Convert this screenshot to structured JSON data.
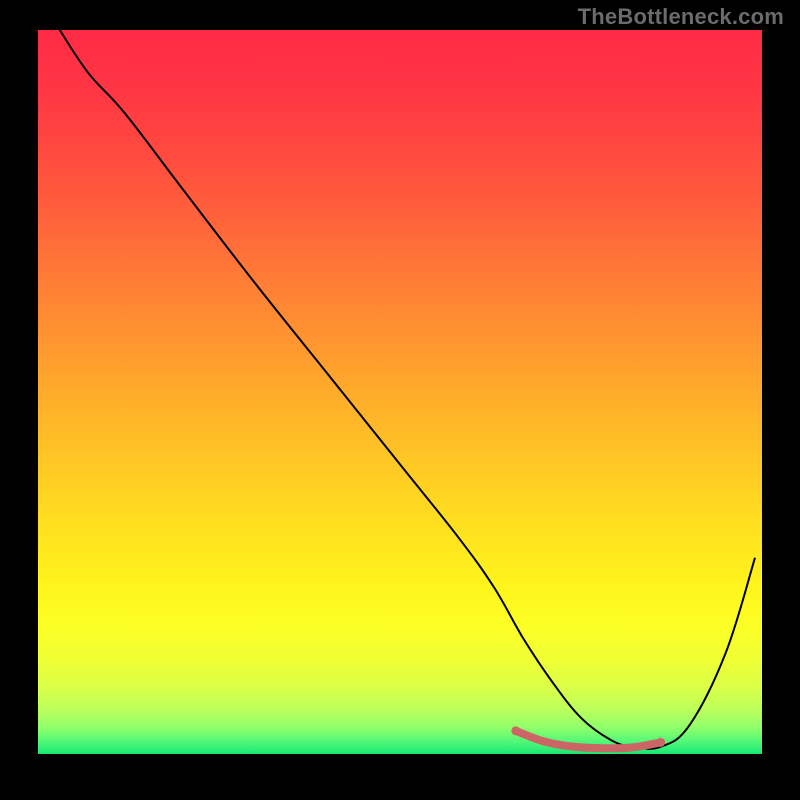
{
  "watermark": {
    "text": "TheBottleneck.com"
  },
  "gradient": {
    "stops": [
      {
        "offset": 0.0,
        "color": "#ff2b46"
      },
      {
        "offset": 0.085,
        "color": "#ff3643"
      },
      {
        "offset": 0.17,
        "color": "#ff4a3f"
      },
      {
        "offset": 0.255,
        "color": "#ff613b"
      },
      {
        "offset": 0.34,
        "color": "#ff7b36"
      },
      {
        "offset": 0.425,
        "color": "#ff9430"
      },
      {
        "offset": 0.51,
        "color": "#ffae2a"
      },
      {
        "offset": 0.6,
        "color": "#ffc824"
      },
      {
        "offset": 0.685,
        "color": "#ffe01f"
      },
      {
        "offset": 0.765,
        "color": "#fff41c"
      },
      {
        "offset": 0.82,
        "color": "#fdff24"
      },
      {
        "offset": 0.87,
        "color": "#efff34"
      },
      {
        "offset": 0.91,
        "color": "#d9ff48"
      },
      {
        "offset": 0.94,
        "color": "#b9ff5c"
      },
      {
        "offset": 0.965,
        "color": "#8cff6c"
      },
      {
        "offset": 0.982,
        "color": "#55f878"
      },
      {
        "offset": 1.0,
        "color": "#18e874"
      }
    ]
  },
  "chart_data": {
    "type": "line",
    "title": "",
    "xlabel": "",
    "ylabel": "",
    "xlim": [
      0,
      100
    ],
    "ylim": [
      0,
      100
    ],
    "series": [
      {
        "name": "bottleneck-curve",
        "color": "#000000",
        "stroke_width": 2,
        "x": [
          3,
          7,
          12,
          20,
          30,
          40,
          50,
          58,
          63,
          67,
          71,
          75,
          79,
          82,
          86,
          90,
          95,
          99
        ],
        "y": [
          100,
          94,
          88.5,
          78,
          65,
          52.5,
          40,
          30,
          23,
          16,
          10,
          5,
          2,
          1,
          1,
          4,
          14,
          27
        ]
      }
    ],
    "emphasis_segment": {
      "color": "#cc6666",
      "stroke_width": 8,
      "dots_radius": 4.5,
      "x": [
        66,
        70,
        74,
        78,
        82,
        86
      ],
      "y": [
        3.2,
        1.7,
        1.0,
        0.8,
        0.9,
        1.6
      ]
    },
    "grid": false,
    "legend": false
  }
}
